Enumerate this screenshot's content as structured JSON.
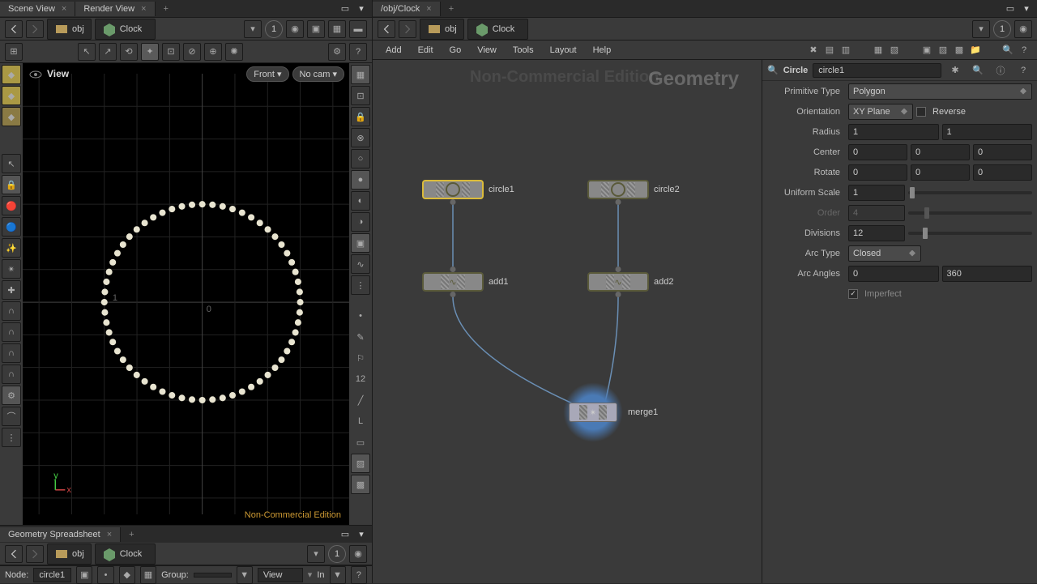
{
  "left": {
    "tabs": [
      "Scene View",
      "Render View"
    ],
    "path": {
      "level1": "obj",
      "level2": "Clock",
      "num": "1"
    },
    "viewport": {
      "label": "View",
      "pill_view": "Front",
      "pill_cam": "No cam",
      "watermark": "Non-Commercial Edition"
    },
    "bottom_tabs": [
      "Geometry Spreadsheet"
    ],
    "bottom_path": {
      "level1": "obj",
      "level2": "Clock",
      "num": "1"
    },
    "status": {
      "node_label": "Node:",
      "node_value": "circle1",
      "group_label": "Group:",
      "view_label": "View",
      "intr_label": "In"
    }
  },
  "right": {
    "tabs": [
      "/obj/Clock"
    ],
    "path": {
      "level1": "obj",
      "level2": "Clock",
      "num": "1"
    },
    "menus": [
      "Add",
      "Edit",
      "Go",
      "View",
      "Tools",
      "Layout",
      "Help"
    ],
    "wm1": "Non-Commercial Edition",
    "wm2": "Geometry",
    "nodes": {
      "circle1": "circle1",
      "circle2": "circle2",
      "add1": "add1",
      "add2": "add2",
      "merge1": "merge1"
    }
  },
  "params": {
    "type": "Circle",
    "name": "circle1",
    "rows": {
      "primtype": {
        "label": "Primitive Type",
        "value": "Polygon"
      },
      "orient": {
        "label": "Orientation",
        "value": "XY Plane",
        "reverse": "Reverse"
      },
      "radius": {
        "label": "Radius",
        "v1": "1",
        "v2": "1"
      },
      "center": {
        "label": "Center",
        "v1": "0",
        "v2": "0",
        "v3": "0"
      },
      "rotate": {
        "label": "Rotate",
        "v1": "0",
        "v2": "0",
        "v3": "0"
      },
      "scale": {
        "label": "Uniform Scale",
        "v": "1"
      },
      "order": {
        "label": "Order",
        "v": "4"
      },
      "div": {
        "label": "Divisions",
        "v": "12"
      },
      "arctype": {
        "label": "Arc Type",
        "value": "Closed"
      },
      "arcang": {
        "label": "Arc Angles",
        "v1": "0",
        "v2": "360"
      },
      "imperfect": {
        "label": "Imperfect"
      }
    }
  }
}
